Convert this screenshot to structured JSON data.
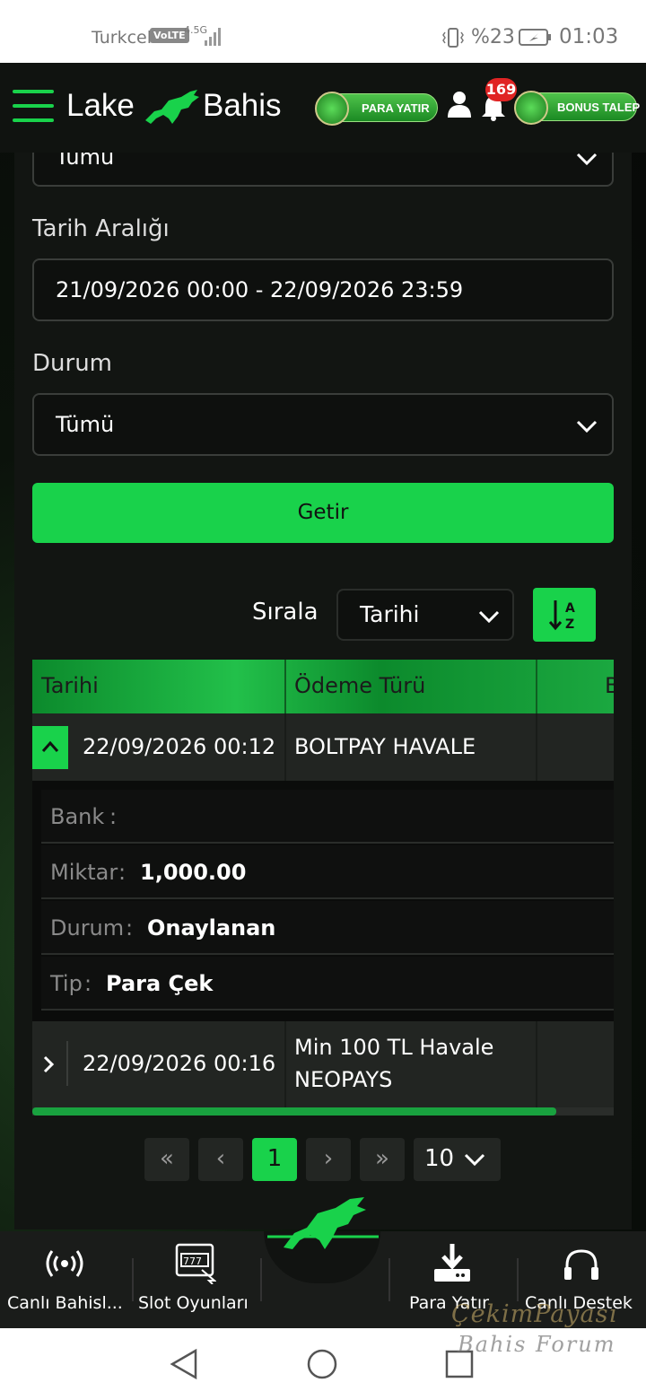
{
  "status_bar": {
    "carrier": "Turkcell",
    "volte": "VoLTE",
    "network": "4.5G",
    "battery": "%23",
    "time": "01:03"
  },
  "header": {
    "logo_left": "Lake",
    "logo_right": "Bahis",
    "deposit_button": "PARA YATIR",
    "notification_count": "169",
    "bonus_button": "BONUS TALEP"
  },
  "filters": {
    "top_select_value": "Tümü",
    "date_range_label": "Tarih Aralığı",
    "date_range_value": "21/09/2026 00:00 - 22/09/2026 23:59",
    "status_label": "Durum",
    "status_value": "Tümü",
    "submit_button": "Getir"
  },
  "sort": {
    "label": "Sırala",
    "value": "Tarihi",
    "sort_icon": "sort-az-icon"
  },
  "table": {
    "columns": [
      "Tarihi",
      "Ödeme Türü",
      "B"
    ],
    "rows": [
      {
        "date": "22/09/2026 00:12",
        "payment_type": "BOLTPAY HAVALE",
        "expanded": true
      },
      {
        "date": "22/09/2026 00:16",
        "payment_type_line1": "Min 100 TL Havale",
        "payment_type_line2": "NEOPAYS",
        "expanded": false
      }
    ],
    "detail": [
      {
        "key": "Bank",
        "sep": ":",
        "value": ""
      },
      {
        "key": "Miktar",
        "sep": ":",
        "value": "1,000.00"
      },
      {
        "key": "Durum",
        "sep": ":",
        "value": "Onaylanan"
      },
      {
        "key": "Tip",
        "sep": ":",
        "value": "Para Çek"
      }
    ]
  },
  "pagination": {
    "first": "«",
    "prev": "‹",
    "current": "1",
    "next": "›",
    "last": "»",
    "page_size": "10"
  },
  "bottom_nav": {
    "items": [
      "Canlı Bahisl...",
      "Slot Oyunları",
      "Para Yatır",
      "Canlı Destek"
    ]
  },
  "watermark": {
    "line1": "ÇekimPayası",
    "line2": "Bahis Forum"
  },
  "colors": {
    "accent": "#19d24b",
    "panel": "#121512",
    "row": "#222522"
  }
}
